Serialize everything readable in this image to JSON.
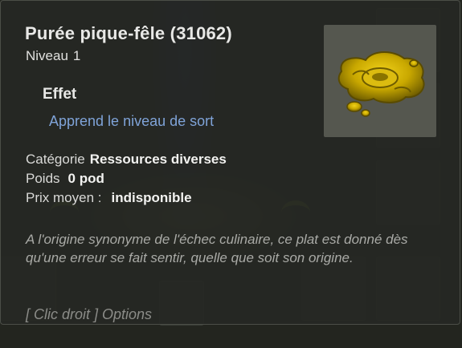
{
  "item": {
    "name": "Purée pique-fêle (31062)",
    "level_label": "Niveau",
    "level_value": "1",
    "image_icon": "puree-blob-icon"
  },
  "effect": {
    "heading": "Effet",
    "lines": [
      "Apprend le niveau de sort"
    ]
  },
  "properties": {
    "category_label": "Catégorie",
    "category_value": "Ressources diverses",
    "weight_label": "Poids",
    "weight_value": "0 pod",
    "price_label": "Prix moyen :",
    "price_value": "indisponible"
  },
  "description": "A l'origine synonyme de l'échec culinaire, ce plat est donné dès qu'une erreur se fait sentir, quelle que soit son origine.",
  "hint": "[ Clic droit ] Options",
  "colors": {
    "effect_text": "#7fa3d8",
    "title_text": "#e8e8e6",
    "description_text": "#a9aaa6",
    "item_gold": "#c9a800"
  }
}
